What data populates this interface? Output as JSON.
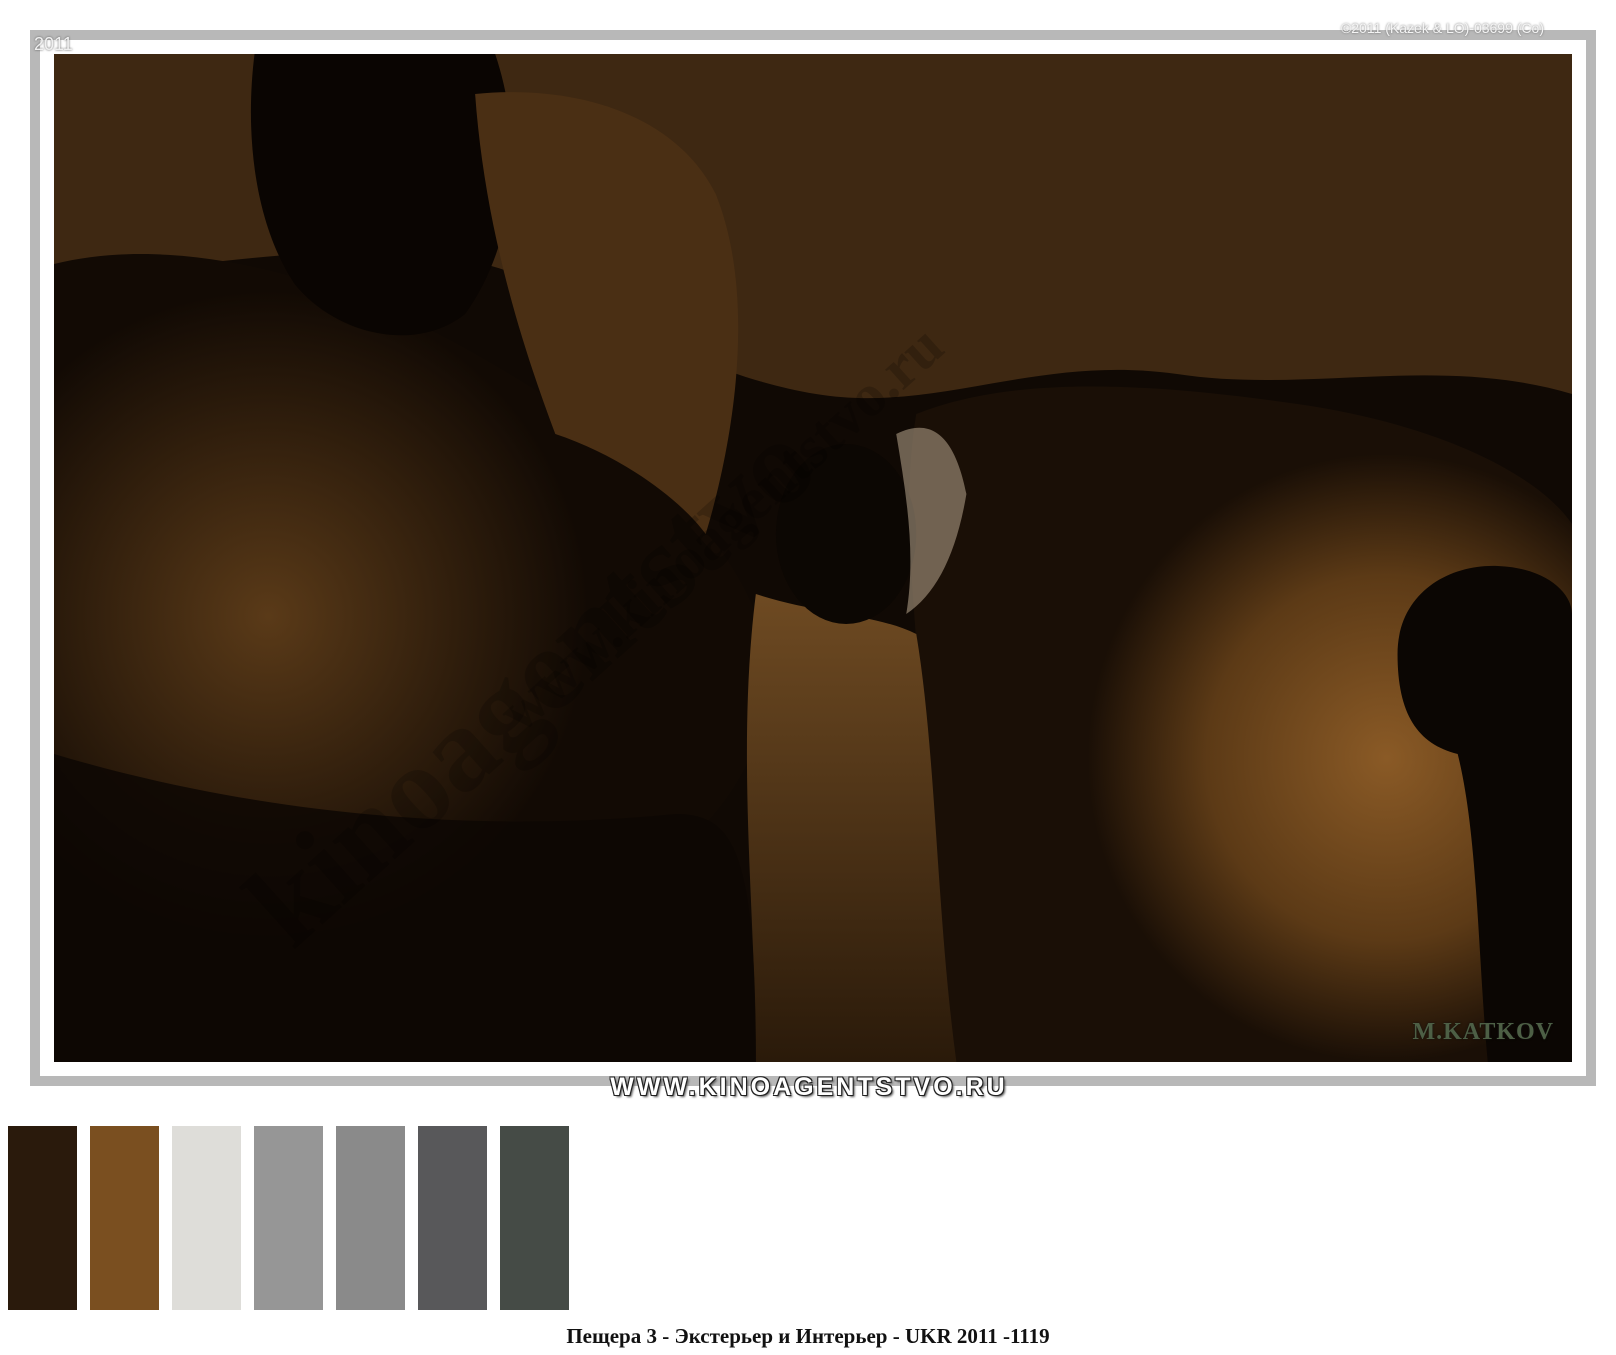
{
  "overlay": {
    "year": "2011",
    "copyright": "©2011 (Kazek & LO)-03699 (Co)"
  },
  "photo": {
    "signature": "M.KATKOV",
    "watermark_large": "kinoagentstvo",
    "watermark_small": "www.kinoagentstvo.ru"
  },
  "banner": {
    "text": "WWW.KINOAGENTSTVO.RU"
  },
  "palette": {
    "colors": [
      "#2a1a0c",
      "#7a4f20",
      "#deddd9",
      "#969696",
      "#8a8a8a",
      "#58585a",
      "#454b46"
    ]
  },
  "caption": {
    "text": "Пещера 3 - Экстерьер и Интерьер - UKR 2011 -1119"
  }
}
